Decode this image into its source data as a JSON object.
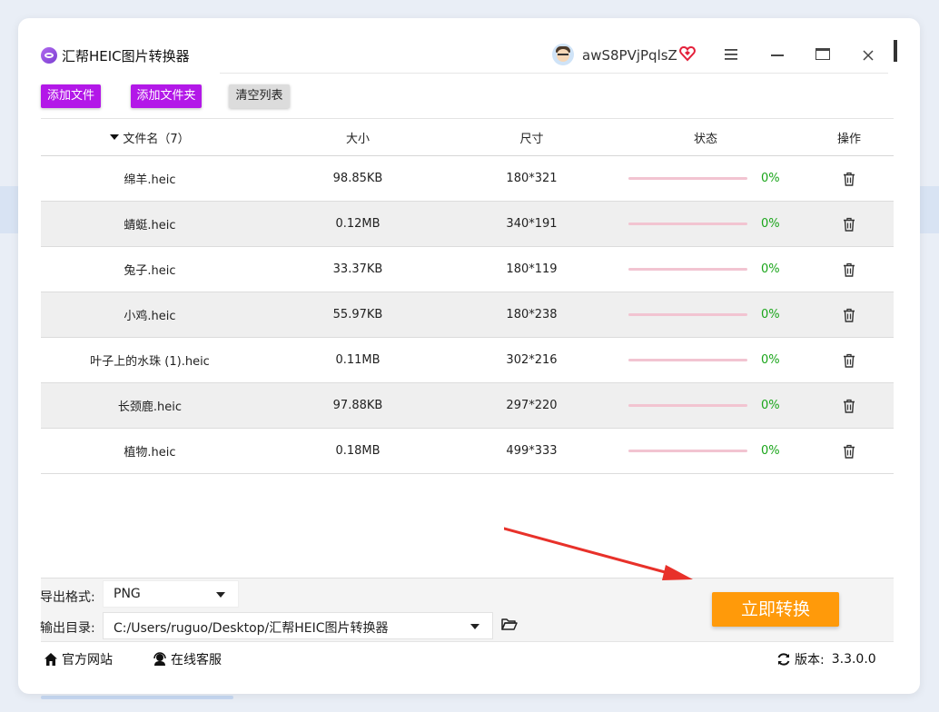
{
  "window": {
    "title": "汇帮HEIC图片转换器",
    "username": "awS8PVjPqlsZ"
  },
  "toolbar": {
    "add_file": "添加文件",
    "add_folder": "添加文件夹",
    "clear_list": "清空列表"
  },
  "table": {
    "headers": {
      "name": "文件名（7）",
      "size": "大小",
      "dimensions": "尺寸",
      "status": "状态",
      "actions": "操作"
    },
    "rows": [
      {
        "name": "绵羊.heic",
        "size": "98.85KB",
        "dimensions": "180*321",
        "progress_pct": 0,
        "progress": "0%"
      },
      {
        "name": "蜻蜓.heic",
        "size": "0.12MB",
        "dimensions": "340*191",
        "progress_pct": 0,
        "progress": "0%"
      },
      {
        "name": "兔子.heic",
        "size": "33.37KB",
        "dimensions": "180*119",
        "progress_pct": 0,
        "progress": "0%"
      },
      {
        "name": "小鸡.heic",
        "size": "55.97KB",
        "dimensions": "180*238",
        "progress_pct": 0,
        "progress": "0%"
      },
      {
        "name": "叶子上的水珠 (1).heic",
        "size": "0.11MB",
        "dimensions": "302*216",
        "progress_pct": 0,
        "progress": "0%"
      },
      {
        "name": "长颈鹿.heic",
        "size": "97.88KB",
        "dimensions": "297*220",
        "progress_pct": 0,
        "progress": "0%"
      },
      {
        "name": "植物.heic",
        "size": "0.18MB",
        "dimensions": "499*333",
        "progress_pct": 0,
        "progress": "0%"
      }
    ]
  },
  "settings": {
    "format_label": "导出格式:",
    "format_value": "PNG",
    "output_label": "输出目录:",
    "output_value": "C:/Users/ruguo/Desktop/汇帮HEIC图片转换器"
  },
  "convert_button": "立即转换",
  "footer": {
    "website": "官方网站",
    "support": "在线客服",
    "version_label": "版本:",
    "version_value": "3.3.0.0"
  },
  "colors": {
    "accent_purple": "#b318e8",
    "convert_orange": "#ff9a0a",
    "progress_track": "#f2c4d1",
    "percent_green": "#1aa51a",
    "arrow_red": "#e8312a"
  },
  "icons": [
    "app-logo-icon",
    "avatar-icon",
    "vip-heart-icon",
    "menu-icon",
    "minimize-icon",
    "maximize-icon",
    "close-icon",
    "sort-caret-icon",
    "trash-icon",
    "dropdown-caret-icon",
    "folder-open-icon",
    "home-icon",
    "headset-icon",
    "refresh-icon"
  ]
}
